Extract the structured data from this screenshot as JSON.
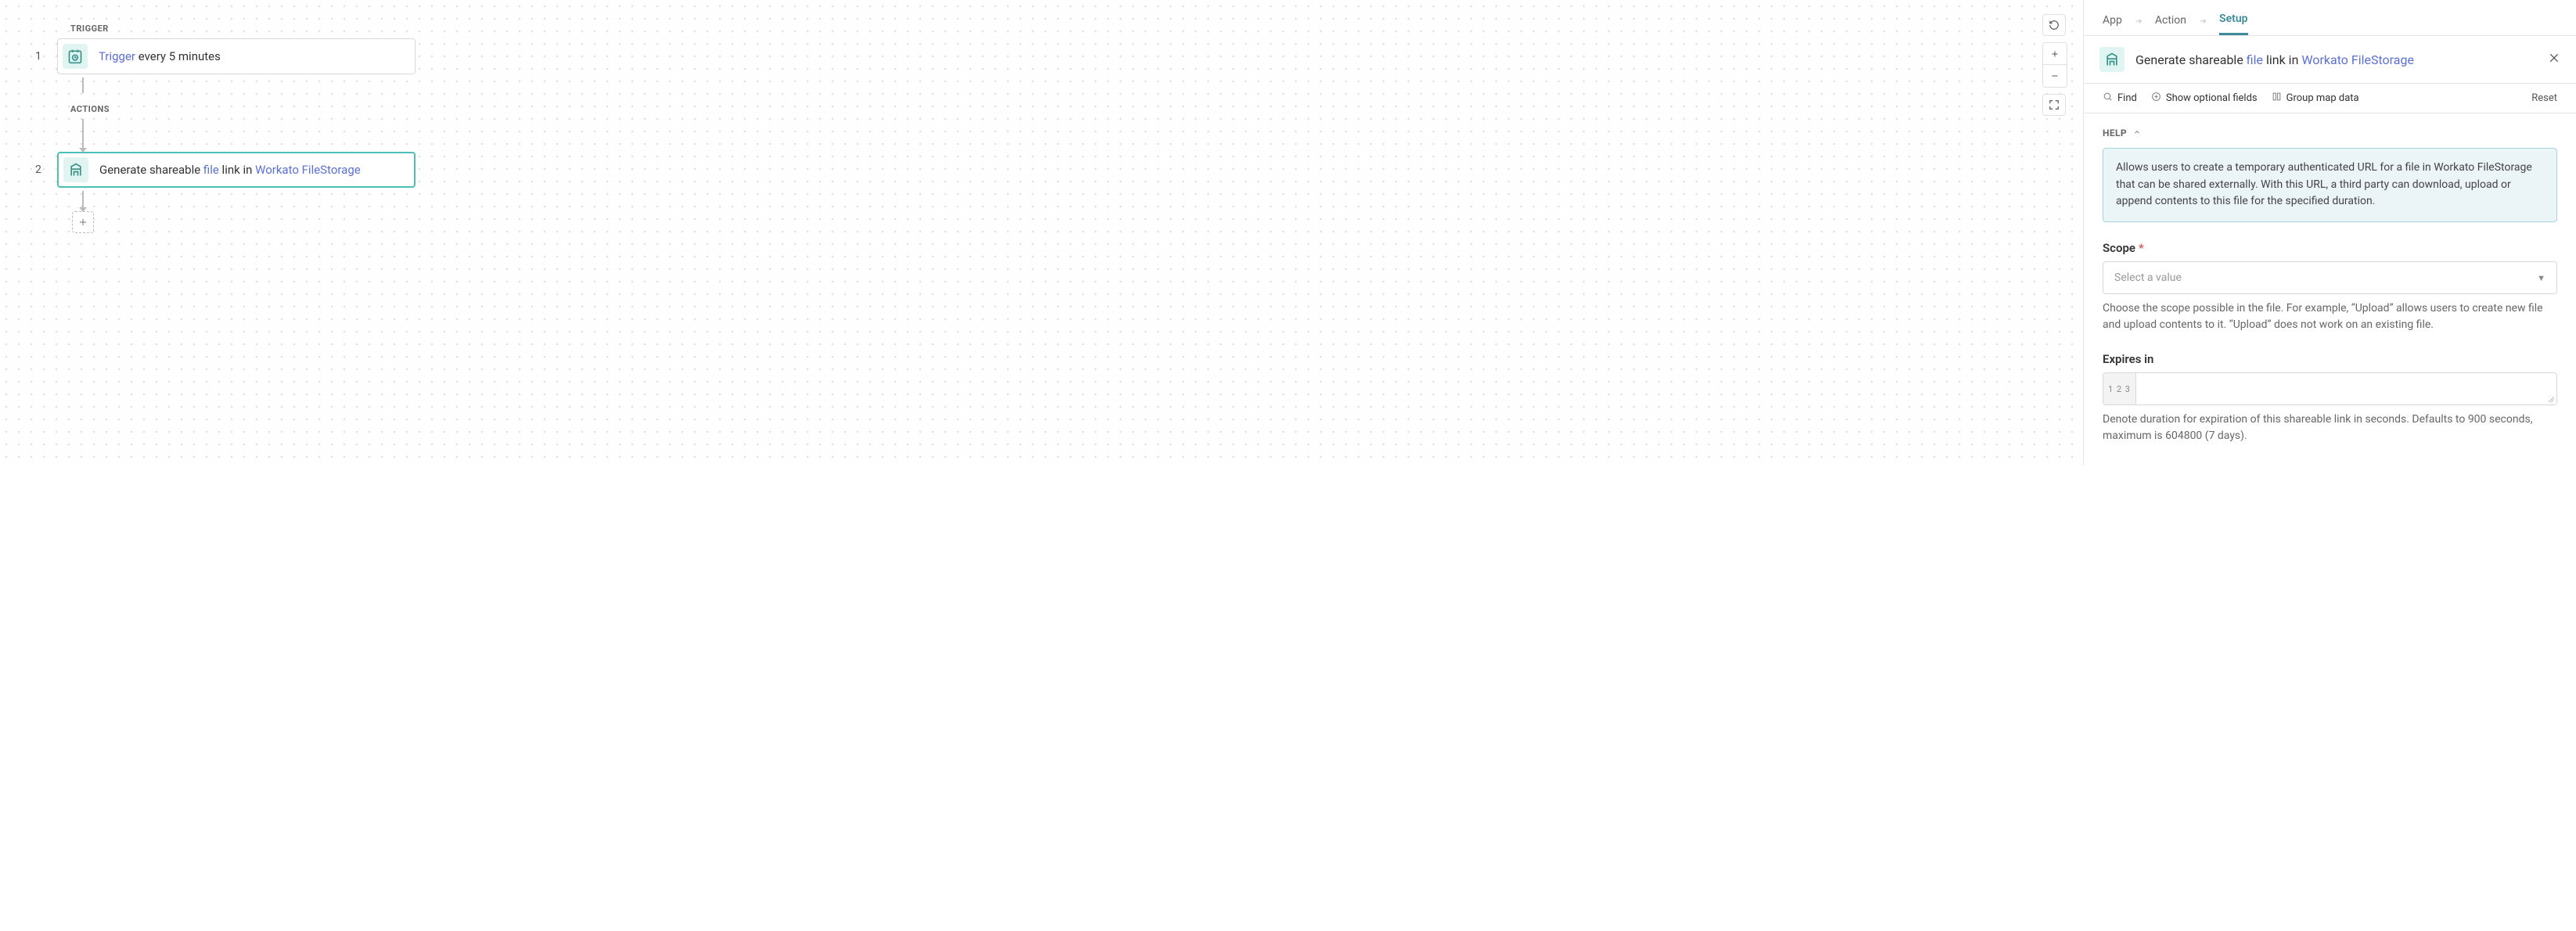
{
  "canvas": {
    "trigger_label": "TRIGGER",
    "actions_label": "ACTIONS",
    "step1": {
      "num": "1",
      "prefix": "Trigger",
      "rest": " every 5 minutes"
    },
    "step2": {
      "num": "2",
      "t1": "Generate shareable ",
      "t2": "file",
      "t3": " link in ",
      "t4": "Workato FileStorage"
    }
  },
  "breadcrumb": {
    "app": "App",
    "action": "Action",
    "setup": "Setup"
  },
  "panel": {
    "title": {
      "t1": "Generate shareable ",
      "t2": "file",
      "t3": " link in ",
      "t4": "Workato FileStorage"
    },
    "find": "Find",
    "show_optional": "Show optional fields",
    "group_map": "Group map data",
    "reset": "Reset"
  },
  "help": {
    "label": "HELP",
    "text": "Allows users to create a temporary authenticated URL for a file in Workato FileStorage that can be shared externally. With this URL, a third party can download, upload or append contents to this file for the specified duration."
  },
  "fields": {
    "scope": {
      "label": "Scope",
      "placeholder": "Select a value",
      "hint": "Choose the scope possible in the file. For example, “Upload” allows users to create new file and upload contents to it. “Upload” does not work on an existing file."
    },
    "expires": {
      "label": "Expires in",
      "prefix": "1 2 3",
      "hint": "Denote duration for expiration of this shareable link in seconds. Defaults to 900 seconds, maximum is 604800 (7 days)."
    }
  }
}
